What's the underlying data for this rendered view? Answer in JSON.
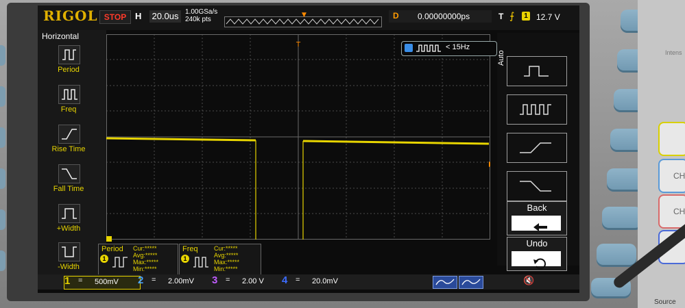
{
  "brand": "RIGOL",
  "run_state": "STOP",
  "horizontal": {
    "badge": "H",
    "timebase": "20.0us",
    "sample_rate": "1.00GSa/s",
    "memory": "240k pts"
  },
  "delay": {
    "label": "D",
    "value": "0.00000000ps"
  },
  "trigger": {
    "type": "T",
    "edge_icon": "rising-edge-icon",
    "source": "1",
    "level": "12.7 V"
  },
  "left_menu": {
    "title": "Horizontal",
    "items": [
      {
        "label": "Period",
        "icon": "period-icon"
      },
      {
        "label": "Freq",
        "icon": "freq-icon"
      },
      {
        "label": "Rise Time",
        "icon": "rise-time-icon"
      },
      {
        "label": "Fall Time",
        "icon": "fall-time-icon"
      },
      {
        "label": "+Width",
        "icon": "positive-width-icon"
      },
      {
        "label": "-Width",
        "icon": "negative-width-icon"
      }
    ]
  },
  "freq_indicator": {
    "text": "< 15Hz"
  },
  "right_menu": {
    "mode": "Auto",
    "back": "Back",
    "undo": "Undo"
  },
  "measurements": [
    {
      "name": "Period",
      "channel": "1",
      "cur": "Cur:*****",
      "avg": "Avg:*****",
      "max": "Max:*****",
      "min": "Min:*****"
    },
    {
      "name": "Freq",
      "channel": "1",
      "cur": "Cur:*****",
      "avg": "Avg:*****",
      "max": "Max:*****",
      "min": "Min:*****"
    }
  ],
  "channels": [
    {
      "num": "1",
      "coupling": "=",
      "volts": "500mV",
      "color": "#e8d500"
    },
    {
      "num": "2",
      "coupling": "=",
      "volts": "2.00mV",
      "color": "#4aa3ff"
    },
    {
      "num": "3",
      "coupling": "=",
      "volts": "2.00 V",
      "color": "#c05cff"
    },
    {
      "num": "4",
      "coupling": "=",
      "volts": "20.0mV",
      "color": "#3c6cff"
    }
  ],
  "panel": {
    "intensity": "Intens",
    "source": "Source"
  },
  "colors": {
    "trace": "#e8d500",
    "trigger": "#ff8a00",
    "grid": "#5a5a5a"
  }
}
